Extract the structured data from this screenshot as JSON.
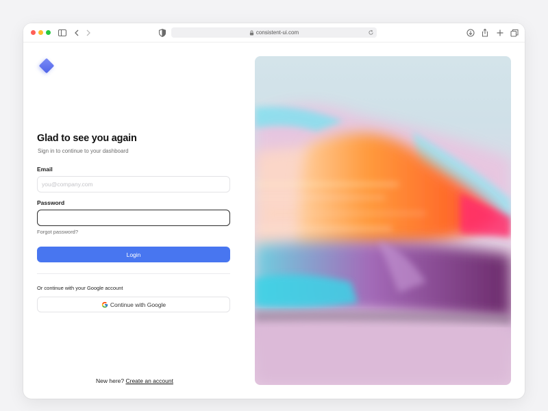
{
  "browser": {
    "url": "consistent-ui.com"
  },
  "form": {
    "heading": "Glad to see you again",
    "subheading": "Sign in to continue to your dashboard",
    "email_label": "Email",
    "email_placeholder": "you@company.com",
    "email_value": "",
    "password_label": "Password",
    "password_value": "",
    "forgot_password": "Forgot password?",
    "login_label": "Login",
    "or_continue": "Or continue with your Google account",
    "google_label": "Continue with Google"
  },
  "footer": {
    "prompt": "New here?",
    "link": "Create an account"
  },
  "colors": {
    "primary": "#4876f0",
    "logo": "#5b6ff0"
  }
}
